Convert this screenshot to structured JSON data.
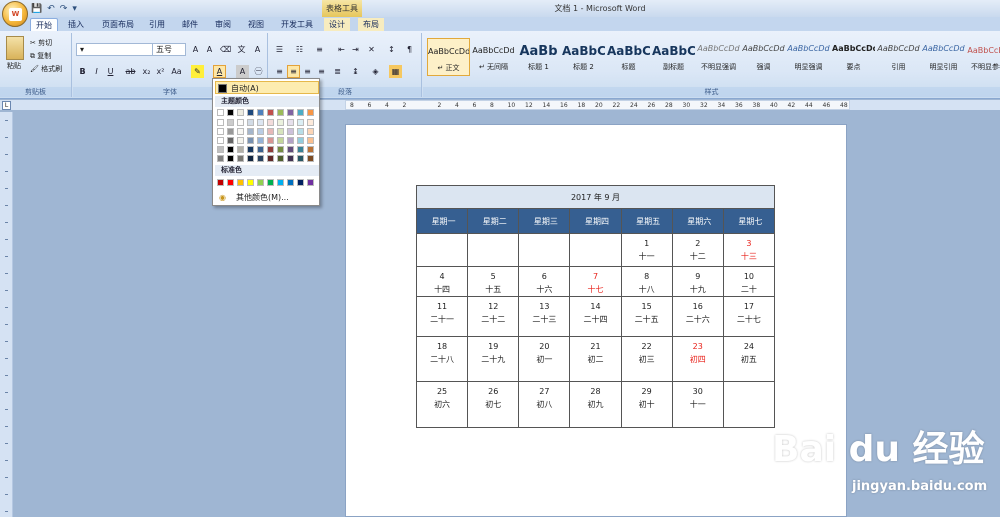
{
  "window": {
    "context_tool": "表格工具",
    "doc_title": "文档 1 - Microsoft Word",
    "qat_icons": [
      "save-icon",
      "undo-icon",
      "redo-icon",
      "customize-icon"
    ]
  },
  "tabs": [
    "开始",
    "插入",
    "页面布局",
    "引用",
    "邮件",
    "审阅",
    "视图",
    "开发工具",
    "设计",
    "布局"
  ],
  "ribbon": {
    "clipboard": {
      "paste": "粘贴",
      "cut": "剪切",
      "copy": "复制",
      "format_painter": "格式刷",
      "label": "剪贴板"
    },
    "font": {
      "font_size": "五号",
      "label": "字体"
    },
    "paragraph": {
      "label": "段落"
    },
    "styles": {
      "label": "样式",
      "items": [
        {
          "sample": "AaBbCcDd",
          "name": "↵ 正文"
        },
        {
          "sample": "AaBbCcDd",
          "name": "↵ 无间隔"
        },
        {
          "sample": "AaBb",
          "name": "标题 1"
        },
        {
          "sample": "AaBbC",
          "name": "标题 2"
        },
        {
          "sample": "AaBbC",
          "name": "标题"
        },
        {
          "sample": "AaBbC",
          "name": "副标题"
        },
        {
          "sample": "AaBbCcDd",
          "name": "不明显强调"
        },
        {
          "sample": "AaBbCcDd",
          "name": "强调"
        },
        {
          "sample": "AaBbCcDd",
          "name": "明显强调"
        },
        {
          "sample": "AaBbCcDd",
          "name": "要点"
        },
        {
          "sample": "AaBbCcDd",
          "name": "引用"
        },
        {
          "sample": "AaBbCcDd",
          "name": "明显引用"
        },
        {
          "sample": "AaBbCcDd",
          "name": "不明显参考"
        }
      ]
    }
  },
  "color_menu": {
    "auto": "自动(A)",
    "theme_label": "主题颜色",
    "standard_label": "标准色",
    "more": "其他颜色(M)...",
    "theme_top": [
      "#ffffff",
      "#000000",
      "#eeece1",
      "#1f497d",
      "#4f81bd",
      "#c0504d",
      "#9bbb59",
      "#8064a2",
      "#4bacc6",
      "#f79646"
    ],
    "standard": [
      "#c00000",
      "#ff0000",
      "#ffc000",
      "#ffff00",
      "#92d050",
      "#00b050",
      "#00b0f0",
      "#0070c0",
      "#002060",
      "#7030a0"
    ]
  },
  "ruler_numbers": [
    "8",
    "6",
    "4",
    "2",
    "",
    "2",
    "4",
    "6",
    "8",
    "10",
    "12",
    "14",
    "16",
    "18",
    "20",
    "22",
    "24",
    "26",
    "28",
    "30",
    "32",
    "34",
    "36",
    "38",
    "40",
    "42",
    "44",
    "46",
    "48"
  ],
  "calendar": {
    "title": "2017 年 9 月",
    "weekdays": [
      "星期一",
      "星期二",
      "星期三",
      "星期四",
      "星期五",
      "星期六",
      "星期七"
    ],
    "weeks": [
      [
        {
          "n": "",
          "l": ""
        },
        {
          "n": "",
          "l": ""
        },
        {
          "n": "",
          "l": ""
        },
        {
          "n": "",
          "l": ""
        },
        {
          "n": "1",
          "l": "十一"
        },
        {
          "n": "2",
          "l": "十二"
        },
        {
          "n": "3",
          "l": "十三",
          "red": true
        }
      ],
      [
        {
          "n": "4",
          "l": "十四"
        },
        {
          "n": "5",
          "l": "十五"
        },
        {
          "n": "6",
          "l": "十六"
        },
        {
          "n": "7",
          "l": "十七",
          "red": true
        },
        {
          "n": "8",
          "l": "十八"
        },
        {
          "n": "9",
          "l": "十九"
        },
        {
          "n": "10",
          "l": "二十"
        }
      ],
      [
        {
          "n": "11",
          "l": "二十一"
        },
        {
          "n": "12",
          "l": "二十二"
        },
        {
          "n": "13",
          "l": "二十三"
        },
        {
          "n": "14",
          "l": "二十四"
        },
        {
          "n": "15",
          "l": "二十五"
        },
        {
          "n": "16",
          "l": "二十六"
        },
        {
          "n": "17",
          "l": "二十七"
        }
      ],
      [
        {
          "n": "18",
          "l": "二十八"
        },
        {
          "n": "19",
          "l": "二十九"
        },
        {
          "n": "20",
          "l": "初一"
        },
        {
          "n": "21",
          "l": "初二"
        },
        {
          "n": "22",
          "l": "初三"
        },
        {
          "n": "23",
          "l": "初四",
          "red": true
        },
        {
          "n": "24",
          "l": "初五"
        }
      ],
      [
        {
          "n": "25",
          "l": "初六"
        },
        {
          "n": "26",
          "l": "初七"
        },
        {
          "n": "27",
          "l": "初八"
        },
        {
          "n": "28",
          "l": "初九"
        },
        {
          "n": "29",
          "l": "初十"
        },
        {
          "n": "30",
          "l": "十一"
        },
        {
          "n": "",
          "l": ""
        }
      ]
    ]
  },
  "watermark": {
    "logo": "Bai du 经验",
    "sub": "jingyan.baidu.com"
  }
}
